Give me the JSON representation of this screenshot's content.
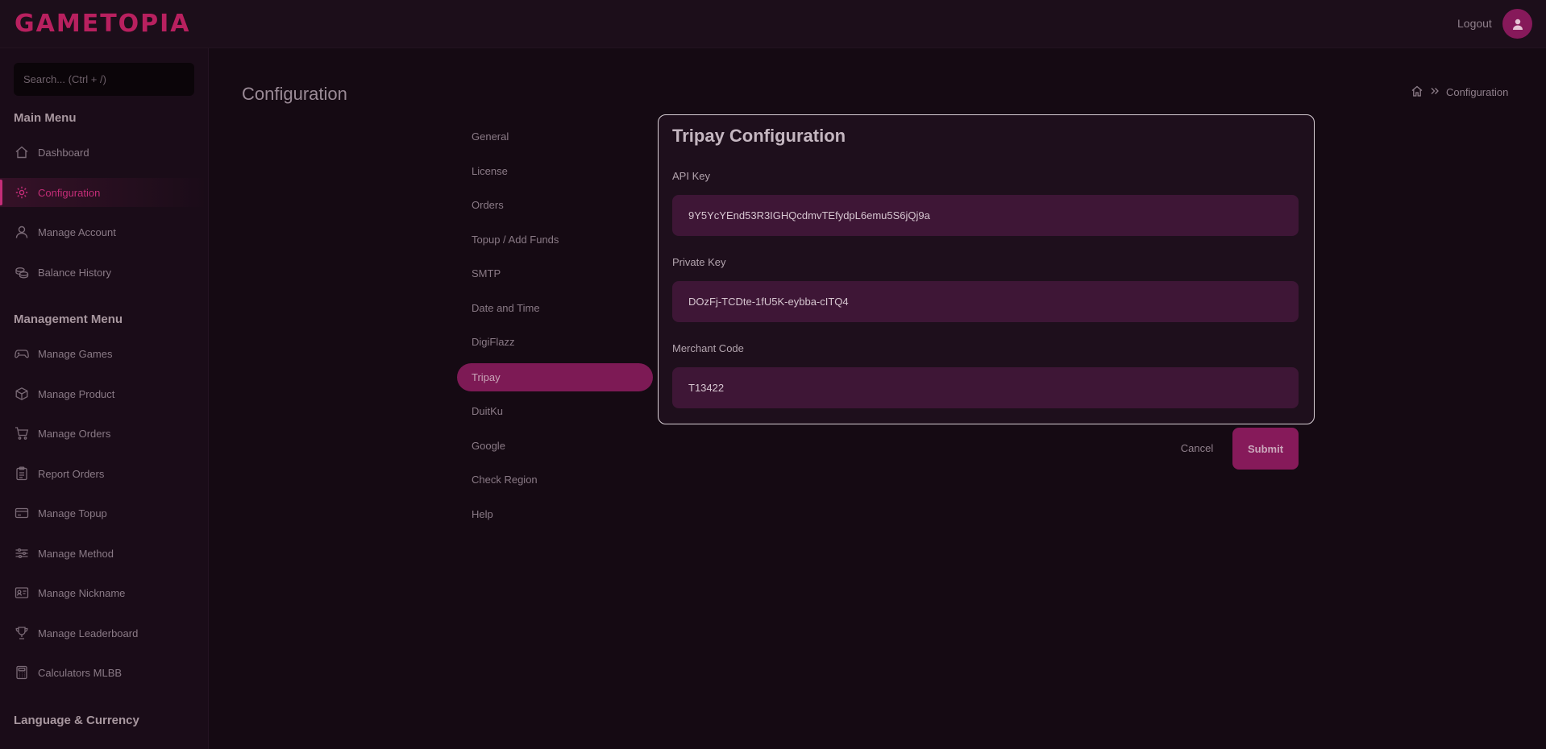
{
  "header": {
    "logo": "GAMETOPIA",
    "logout_label": "Logout",
    "avatar_icon": "user-icon"
  },
  "sidebar": {
    "search_placeholder": "Search... (Ctrl + /)",
    "main_menu_title": "Main Menu",
    "main_items": [
      {
        "label": "Dashboard",
        "icon": "home-icon"
      },
      {
        "label": "Configuration",
        "icon": "gear-icon",
        "active": true
      },
      {
        "label": "Manage Account",
        "icon": "user-icon"
      },
      {
        "label": "Balance History",
        "icon": "coins-icon"
      }
    ],
    "management_menu_title": "Management Menu",
    "management_items": [
      {
        "label": "Manage Games",
        "icon": "gamepad-icon"
      },
      {
        "label": "Manage Product",
        "icon": "box-icon"
      },
      {
        "label": "Manage Orders",
        "icon": "cart-icon"
      },
      {
        "label": "Report Orders",
        "icon": "clipboard-icon"
      },
      {
        "label": "Manage Topup",
        "icon": "card-icon"
      },
      {
        "label": "Manage Method",
        "icon": "sliders-icon"
      },
      {
        "label": "Manage Nickname",
        "icon": "id-card-icon"
      },
      {
        "label": "Manage Leaderboard",
        "icon": "trophy-icon"
      },
      {
        "label": "Calculators MLBB",
        "icon": "calculator-icon"
      }
    ],
    "language_title": "Language & Currency"
  },
  "main": {
    "page_title": "Configuration",
    "breadcrumb": {
      "home_icon": "home-icon",
      "separator_icon": "double-chevron-right-icon",
      "current": "Configuration"
    },
    "config_nav": [
      {
        "label": "General"
      },
      {
        "label": "License"
      },
      {
        "label": "Orders"
      },
      {
        "label": "Topup / Add Funds"
      },
      {
        "label": "SMTP"
      },
      {
        "label": "Date and Time"
      },
      {
        "label": "DigiFlazz"
      },
      {
        "label": "Tripay",
        "active": true
      },
      {
        "label": "DuitKu"
      },
      {
        "label": "Google"
      },
      {
        "label": "Check Region"
      },
      {
        "label": "Help"
      }
    ],
    "card": {
      "title": "Tripay Configuration",
      "fields": [
        {
          "label": "API Key",
          "value": "9Y5YcYEnd53R3IGHQcdmvTEfydpL6emu5S6jQj9a"
        },
        {
          "label": "Private Key",
          "value": "DOzFj-TCDte-1fU5K-eybba-cITQ4"
        },
        {
          "label": "Merchant Code",
          "value": "T13422"
        }
      ]
    },
    "cancel_label": "Cancel",
    "submit_label": "Submit"
  },
  "colors": {
    "accent": "#c42d78",
    "accent_dark": "#861a5a",
    "background": "#150a13",
    "sidebar": "#1a0c18",
    "input": "#3e1636"
  }
}
